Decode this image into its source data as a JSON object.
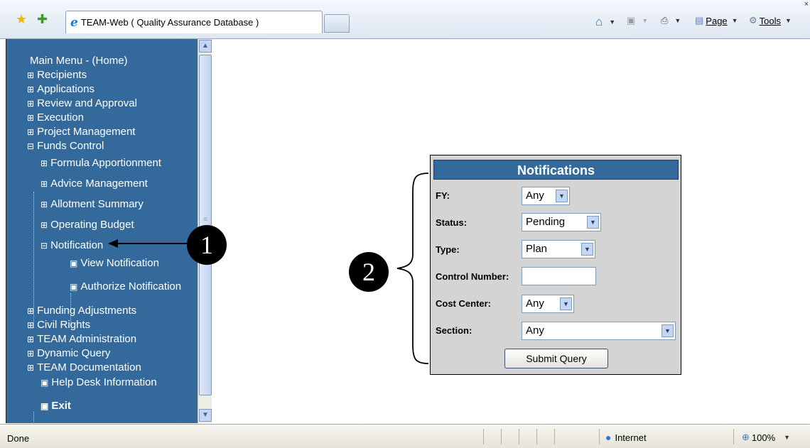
{
  "browser": {
    "tab_title": "TEAM-Web ( Quality Assurance Database )",
    "commands": {
      "page": "Page",
      "tools": "Tools"
    }
  },
  "nav": {
    "items": [
      {
        "label": "Main Menu - (Home)",
        "marker": ""
      },
      {
        "label": "Recipients",
        "marker": "⊞"
      },
      {
        "label": "Applications",
        "marker": "⊞"
      },
      {
        "label": "Review and Approval",
        "marker": "⊞"
      },
      {
        "label": "Execution",
        "marker": "⊞"
      },
      {
        "label": "Project Management",
        "marker": "⊞"
      },
      {
        "label": "Funds Control",
        "marker": "⊟"
      },
      {
        "label": "Formula Apportionment",
        "marker": "⊞"
      },
      {
        "label": "Advice Management",
        "marker": "⊞"
      },
      {
        "label": "Allotment Summary",
        "marker": "⊞"
      },
      {
        "label": "Operating Budget",
        "marker": "⊞"
      },
      {
        "label": "Notification",
        "marker": "⊟"
      },
      {
        "label": "View Notification",
        "marker": "▣"
      },
      {
        "label": "Authorize Notification",
        "marker": "▣"
      },
      {
        "label": "Funding Adjustments",
        "marker": "⊞"
      },
      {
        "label": "Civil Rights",
        "marker": "⊞"
      },
      {
        "label": "TEAM Administration",
        "marker": "⊞"
      },
      {
        "label": "Dynamic Query",
        "marker": "⊞"
      },
      {
        "label": "TEAM Documentation",
        "marker": "⊞"
      },
      {
        "label": "Help Desk Information",
        "marker": "▣"
      },
      {
        "label": "Exit",
        "marker": "▣"
      }
    ]
  },
  "callouts": {
    "one": "1",
    "two": "2"
  },
  "form": {
    "title": "Notifications",
    "fy_label": "FY:",
    "fy_value": "Any",
    "status_label": "Status:",
    "status_value": "Pending",
    "type_label": "Type:",
    "type_value": "Plan",
    "control_label": "Control Number:",
    "control_value": "",
    "cost_center_label": "Cost Center:",
    "cost_center_value": "Any",
    "section_label": "Section:",
    "section_value": "Any",
    "submit_label": "Submit Query"
  },
  "status_bar": {
    "text": "Done",
    "zone": "Internet",
    "zoom": "100%"
  }
}
